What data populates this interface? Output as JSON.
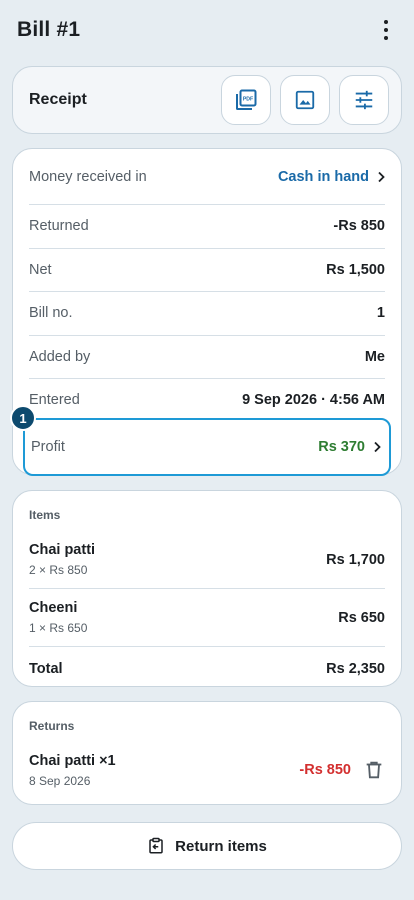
{
  "appbar": {
    "title": "Bill #1",
    "menu_icon": "more-vert-icon"
  },
  "receipt": {
    "title": "Receipt",
    "buttons": [
      {
        "icon": "pdf-icon"
      },
      {
        "icon": "image-icon"
      },
      {
        "icon": "tune-icon"
      }
    ]
  },
  "details": {
    "money_received_label": "Money received in",
    "money_received_value": "Cash in hand",
    "returned_label": "Returned",
    "returned_value": "-Rs 850",
    "net_label": "Net",
    "net_value": "Rs 1,500",
    "bill_no_label": "Bill no.",
    "bill_no_value": "1",
    "added_by_label": "Added by",
    "added_by_value": "Me",
    "entered_label": "Entered",
    "entered_value": "9 Sep 2026 · 4:56 AM",
    "profit_label": "Profit",
    "profit_value": "Rs 370"
  },
  "highlight_badge": "1",
  "items": {
    "label": "Items",
    "list": [
      {
        "name": "Chai patti",
        "sub": "2 × Rs 850",
        "price": "Rs 1,700"
      },
      {
        "name": "Cheeni",
        "sub": "1 × Rs 650",
        "price": "Rs 650"
      }
    ],
    "total_label": "Total",
    "total_value": "Rs 2,350"
  },
  "returns": {
    "label": "Returns",
    "list": [
      {
        "name": "Chai patti ×1",
        "date": "8 Sep 2026",
        "amount": "-Rs 850"
      }
    ]
  },
  "return_button": {
    "label": "Return items"
  },
  "colors": {
    "accent_blue": "#1a6aa8",
    "profit_green": "#2e7d32",
    "negative_red": "#d32f2f",
    "highlight": "#1e9ad6"
  }
}
